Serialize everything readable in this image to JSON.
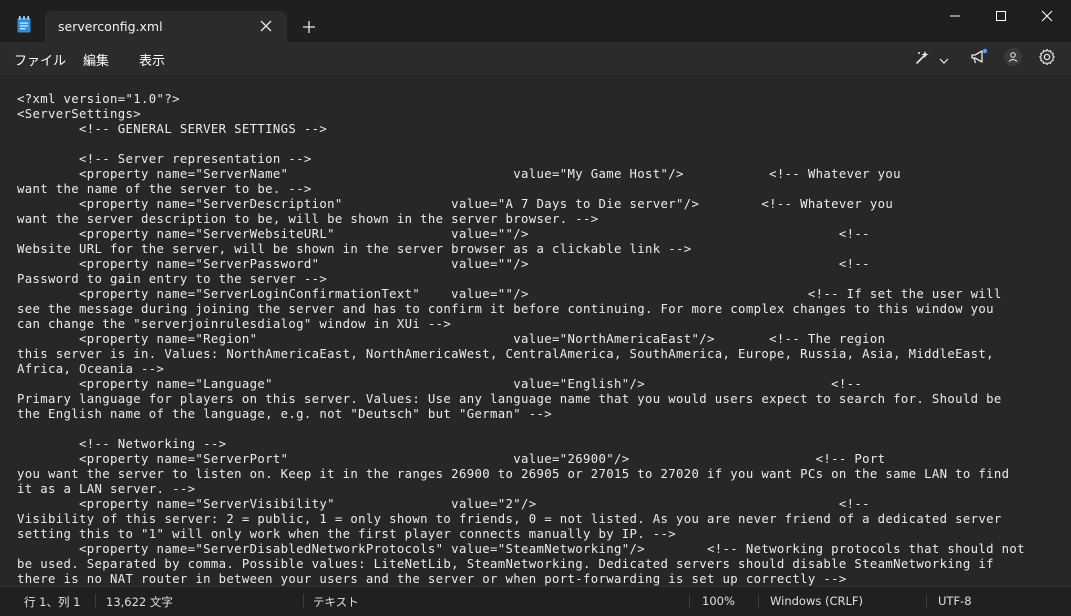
{
  "window": {
    "tab_title": "serverconfig.xml",
    "controls": [
      "minimize",
      "maximize",
      "close"
    ]
  },
  "menu": {
    "file": "ファイル",
    "edit": "編集",
    "view": "表示"
  },
  "toolbar": {
    "icons": [
      "copilot-icon",
      "chevron-down-icon",
      "megaphone-icon",
      "account-icon",
      "gear-icon"
    ]
  },
  "editor": {
    "lines": [
      "<?xml version=\"1.0\"?>",
      "<ServerSettings>",
      "        <!-- GENERAL SERVER SETTINGS -->",
      "",
      "        <!-- Server representation -->",
      "        <property name=\"ServerName\"                             value=\"My Game Host\"/>           <!-- Whatever you",
      "want the name of the server to be. -->",
      "        <property name=\"ServerDescription\"              value=\"A 7 Days to Die server\"/>        <!-- Whatever you",
      "want the server description to be, will be shown in the server browser. -->",
      "        <property name=\"ServerWebsiteURL\"               value=\"\"/>                                        <!--",
      "Website URL for the server, will be shown in the server browser as a clickable link -->",
      "        <property name=\"ServerPassword\"                 value=\"\"/>                                        <!--",
      "Password to gain entry to the server -->",
      "        <property name=\"ServerLoginConfirmationText\"    value=\"\"/>                                    <!-- If set the user will",
      "see the message during joining the server and has to confirm it before continuing. For more complex changes to this window you",
      "can change the \"serverjoinrulesdialog\" window in XUi -->",
      "        <property name=\"Region\"                                 value=\"NorthAmericaEast\"/>       <!-- The region",
      "this server is in. Values: NorthAmericaEast, NorthAmericaWest, CentralAmerica, SouthAmerica, Europe, Russia, Asia, MiddleEast,",
      "Africa, Oceania -->",
      "        <property name=\"Language\"                               value=\"English\"/>                        <!--",
      "Primary language for players on this server. Values: Use any language name that you would users expect to search for. Should be",
      "the English name of the language, e.g. not \"Deutsch\" but \"German\" -->",
      "",
      "        <!-- Networking -->",
      "        <property name=\"ServerPort\"                             value=\"26900\"/>                        <!-- Port",
      "you want the server to listen on. Keep it in the ranges 26900 to 26905 or 27015 to 27020 if you want PCs on the same LAN to find",
      "it as a LAN server. -->",
      "        <property name=\"ServerVisibility\"               value=\"2\"/>                                       <!--",
      "Visibility of this server: 2 = public, 1 = only shown to friends, 0 = not listed. As you are never friend of a dedicated server",
      "setting this to \"1\" will only work when the first player connects manually by IP. -->",
      "        <property name=\"ServerDisabledNetworkProtocols\" value=\"SteamNetworking\"/>        <!-- Networking protocols that should not",
      "be used. Separated by comma. Possible values: LiteNetLib, SteamNetworking. Dedicated servers should disable SteamNetworking if",
      "there is no NAT router in between your users and the server or when port-forwarding is set up correctly -->"
    ]
  },
  "status": {
    "position": "行 1、列 1",
    "char_count": "13,622 文字",
    "format": "テキスト",
    "zoom": "100%",
    "line_ending": "Windows (CRLF)",
    "encoding": "UTF-8"
  }
}
